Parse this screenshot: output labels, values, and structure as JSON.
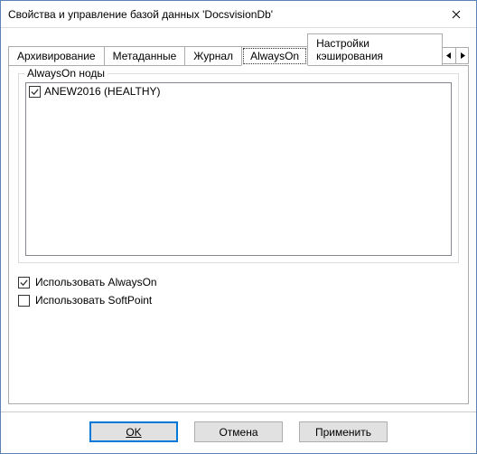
{
  "window": {
    "title": "Свойства и управление базой данных 'DocsvisionDb'"
  },
  "tabs": [
    {
      "label": "Архивирование",
      "active": false
    },
    {
      "label": "Метаданные",
      "active": false
    },
    {
      "label": "Журнал",
      "active": false
    },
    {
      "label": "AlwaysOn",
      "active": true
    },
    {
      "label": "Настройки кэширования",
      "active": false
    }
  ],
  "group": {
    "legend": "AlwaysOn ноды",
    "items": [
      {
        "label": "ANEW2016 (HEALTHY)",
        "checked": true
      }
    ]
  },
  "options": {
    "use_alwayson": {
      "label": "Использовать AlwaysOn",
      "checked": true
    },
    "use_softpoint": {
      "label": "Использовать SoftPoint",
      "checked": false
    }
  },
  "buttons": {
    "ok": "OK",
    "cancel": "Отмена",
    "apply": "Применить"
  }
}
